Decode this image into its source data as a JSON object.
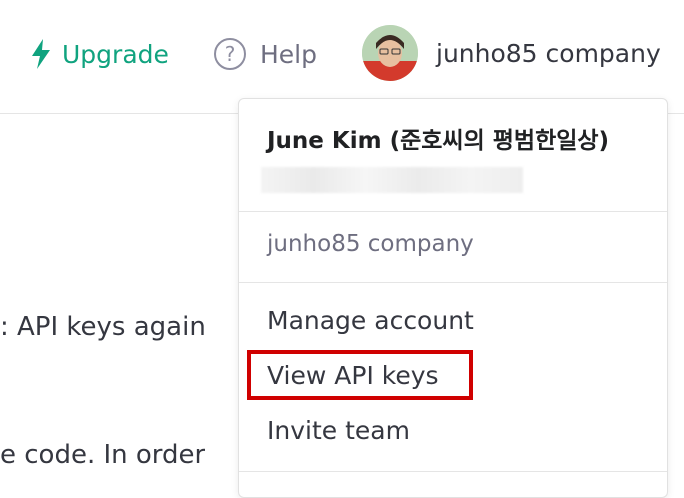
{
  "header": {
    "upgrade_label": "Upgrade",
    "help_label": "Help",
    "account_label": "junho85 company"
  },
  "background": {
    "line1": ": API keys again",
    "line2": "e code. In order"
  },
  "dropdown": {
    "user_name": "June Kim (준호씨의 평범한일상)",
    "org_name": "junho85 company",
    "items": [
      {
        "label": "Manage account"
      },
      {
        "label": "View API keys"
      },
      {
        "label": "Invite team"
      }
    ]
  },
  "colors": {
    "brand": "#10a37f",
    "highlight": "#d00000"
  }
}
